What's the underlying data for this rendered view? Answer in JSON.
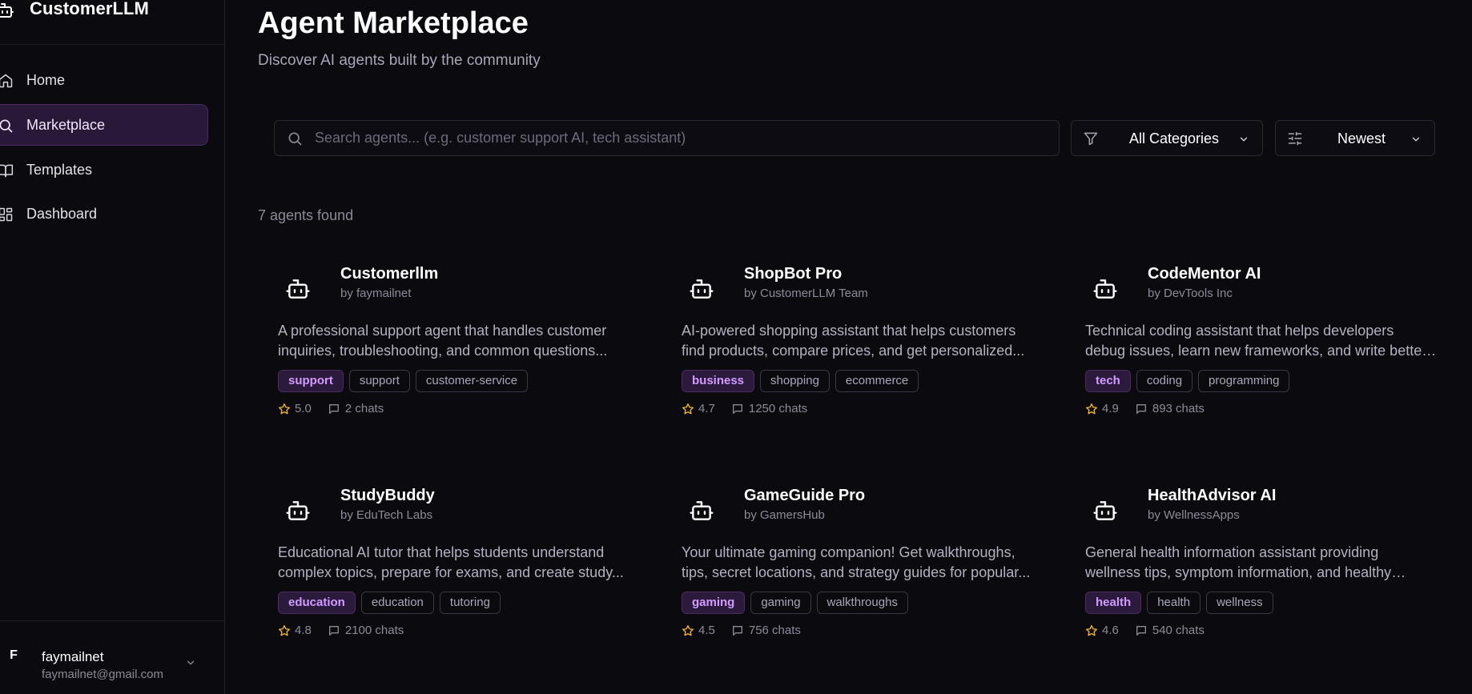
{
  "app": {
    "name": "CustomerLLM"
  },
  "sidebar": {
    "items": [
      {
        "label": "Home",
        "icon": "home-icon",
        "active": false
      },
      {
        "label": "Marketplace",
        "icon": "search-icon",
        "active": true
      },
      {
        "label": "Templates",
        "icon": "book-icon",
        "active": false
      },
      {
        "label": "Dashboard",
        "icon": "dashboard-icon",
        "active": false
      }
    ],
    "user": {
      "initial": "F",
      "name": "faymailnet",
      "email": "faymailnet@gmail.com"
    }
  },
  "header": {
    "title": "Agent Marketplace",
    "subtitle": "Discover AI agents built by the community"
  },
  "filters": {
    "search_placeholder": "Search agents... (e.g. customer support AI, tech assistant)",
    "search_value": "",
    "category": "All Categories",
    "sort": "Newest"
  },
  "results": {
    "count_text": "7 agents found"
  },
  "colors": {
    "accent": "#d29bff",
    "accent_bg": "#2c1a3d",
    "star": "#f5b82e",
    "background": "#0b0a0f"
  },
  "agents": [
    {
      "name": "Customerllm",
      "author": "by faymailnet",
      "description": "A professional support agent that handles customer inquiries, troubleshooting, and common questions...",
      "tags": [
        "support",
        "support",
        "customer-service"
      ],
      "rating": "5.0",
      "chats": "2 chats"
    },
    {
      "name": "ShopBot Pro",
      "author": "by CustomerLLM Team",
      "description": "AI-powered shopping assistant that helps customers find products, compare prices, and get personalized...",
      "tags": [
        "business",
        "shopping",
        "ecommerce"
      ],
      "rating": "4.7",
      "chats": "1250 chats"
    },
    {
      "name": "CodeMentor AI",
      "author": "by DevTools Inc",
      "description": "Technical coding assistant that helps developers debug issues, learn new frameworks, and write better code...",
      "tags": [
        "tech",
        "coding",
        "programming"
      ],
      "rating": "4.9",
      "chats": "893 chats"
    },
    {
      "name": "StudyBuddy",
      "author": "by EduTech Labs",
      "description": "Educational AI tutor that helps students understand complex topics, prepare for exams, and create study...",
      "tags": [
        "education",
        "education",
        "tutoring"
      ],
      "rating": "4.8",
      "chats": "2100 chats"
    },
    {
      "name": "GameGuide Pro",
      "author": "by GamersHub",
      "description": "Your ultimate gaming companion! Get walkthroughs, tips, secret locations, and strategy guides for popular...",
      "tags": [
        "gaming",
        "gaming",
        "walkthroughs"
      ],
      "rating": "4.5",
      "chats": "756 chats"
    },
    {
      "name": "HealthAdvisor AI",
      "author": "by WellnessApps",
      "description": "General health information assistant providing wellness tips, symptom information, and healthy lifestyle...",
      "tags": [
        "health",
        "health",
        "wellness"
      ],
      "rating": "4.6",
      "chats": "540 chats"
    }
  ]
}
